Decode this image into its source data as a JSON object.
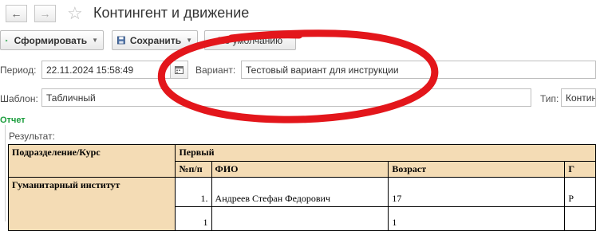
{
  "window": {
    "title": "Контингент и движение",
    "nav_back_icon": "arrow-left-icon",
    "nav_forward_icon": "arrow-right-icon",
    "favorite_icon": "star-icon"
  },
  "toolbar": {
    "generate_label": "Сформировать",
    "save_label": "Сохранить",
    "default_label": "По умолчанию"
  },
  "params": {
    "period_label": "Период:",
    "period_value": "22.11.2024 15:58:49",
    "variant_label": "Вариант:",
    "variant_value": "Тестовый вариант для инструкции",
    "template_label": "Шаблон:",
    "template_value": "Табличный",
    "type_label": "Тип:",
    "type_value": "Контин"
  },
  "report": {
    "group_title": "Отчет",
    "result_label": "Результат:",
    "col_dept": "Подразделение/Курс",
    "col_course": "Первый",
    "col_num": "№п/п",
    "col_fio": "ФИО",
    "col_age": "Возраст",
    "col_extra": "Г",
    "dept_name": "Гуманитарный институт",
    "rows": [
      {
        "num": "1.",
        "fio": "Андреев Стефан Федорович",
        "age": "17",
        "extra": "Р"
      },
      {
        "num": "1",
        "fio": "",
        "age": "1",
        "extra": ""
      }
    ]
  },
  "colors": {
    "accent_green": "#1a9d3c",
    "header_fill": "#f4dcb5",
    "annotation_red": "#e3161b"
  }
}
